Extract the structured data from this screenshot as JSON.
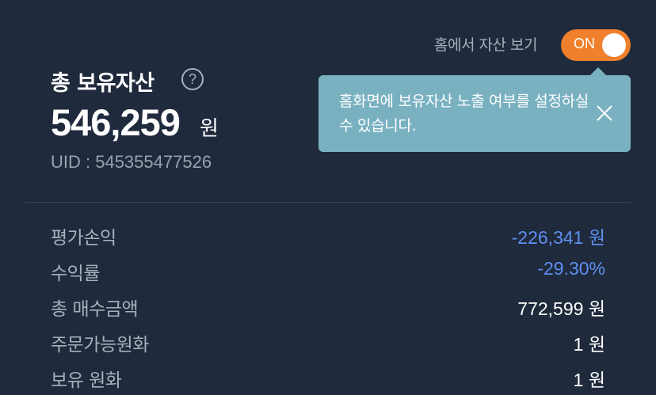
{
  "home_toggle": {
    "label": "홈에서 자산 보기",
    "state_text": "ON",
    "enabled": true
  },
  "assets": {
    "title": "총 보유자산",
    "help_icon_glyph": "?",
    "total_amount": "546,259",
    "total_unit": "원",
    "uid_text": "UID : 545355477526"
  },
  "tooltip": {
    "text": "홈화면에 보유자산 노출 여부를 설정하실 수 있습니다."
  },
  "details": [
    {
      "label": "평가손익",
      "value": "-226,341 원",
      "negative": true
    },
    {
      "label": "수익률",
      "value": "-29.30%",
      "negative": true
    },
    {
      "label": "총 매수금액",
      "value": "772,599 원",
      "negative": false
    },
    {
      "label": "주문가능원화",
      "value": "1 원",
      "negative": false
    },
    {
      "label": "보유 원화",
      "value": "1 원",
      "negative": false
    }
  ],
  "colors": {
    "background": "#1f2a3c",
    "accent_orange": "#f0802c",
    "tooltip_bg": "#79b1c1",
    "negative_blue": "#5f8ff0"
  },
  "icons": {
    "help": "help-circle-icon",
    "close": "close-icon"
  }
}
